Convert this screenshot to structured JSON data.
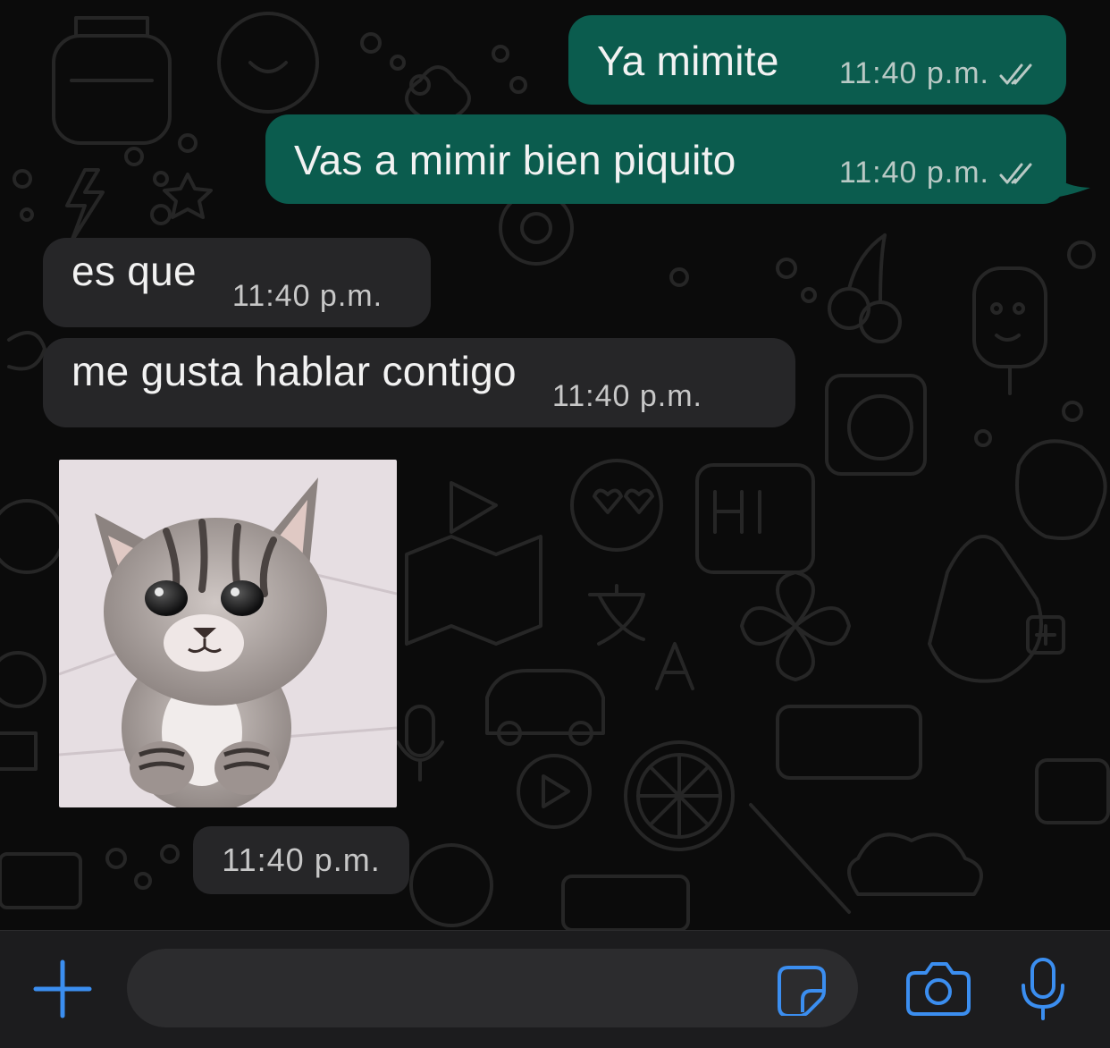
{
  "theme": {
    "outgoing_bubble": "#0b5c4e",
    "incoming_bubble": "#262628",
    "accent": "#3b8ef0",
    "wallpaper_stroke": "#2a2a2a"
  },
  "messages": [
    {
      "direction": "outgoing",
      "text": "Ya mimite",
      "time": "11:40 p.m.",
      "status": "read-double-check"
    },
    {
      "direction": "outgoing",
      "text": "Vas a mimir bien piquito",
      "time": "11:40 p.m.",
      "status": "read-double-check"
    },
    {
      "direction": "incoming",
      "text": "es que",
      "time": "11:40 p.m."
    },
    {
      "direction": "incoming",
      "text": "me gusta hablar contigo",
      "time": "11:40 p.m."
    },
    {
      "direction": "incoming",
      "type": "sticker",
      "image": "sad-kitten-sticker",
      "time": "11:40 p.m."
    }
  ],
  "composer": {
    "placeholder": "",
    "icons": [
      "plus-icon",
      "sticker-icon",
      "camera-icon",
      "microphone-icon"
    ]
  }
}
